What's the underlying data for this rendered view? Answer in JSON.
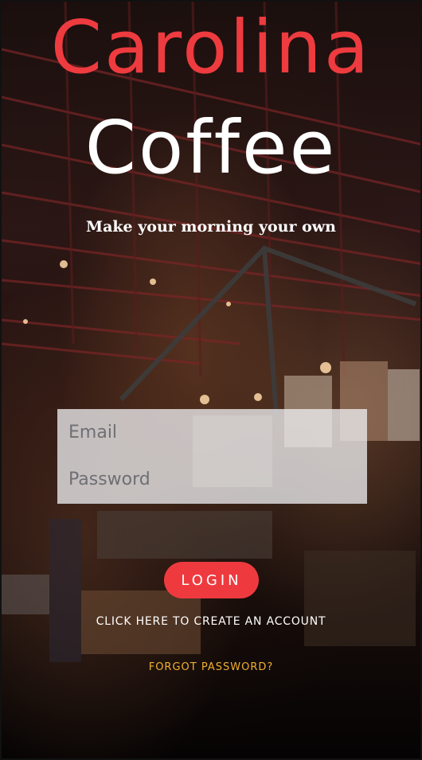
{
  "app": {
    "brand_top": "Carolina",
    "brand_bottom": "Coffee",
    "tagline": "Make your morning your own"
  },
  "form": {
    "email_placeholder": "Email",
    "password_placeholder": "Password",
    "email_value": "",
    "password_value": "",
    "login_label": "LOGIN"
  },
  "links": {
    "create_account": "CLICK HERE TO CREATE AN ACCOUNT",
    "forgot_password": "FORGOT PASSWORD?"
  },
  "colors": {
    "accent_red": "#ee3a3f",
    "link_gold": "#f1b02c",
    "text_white": "#ffffff"
  }
}
